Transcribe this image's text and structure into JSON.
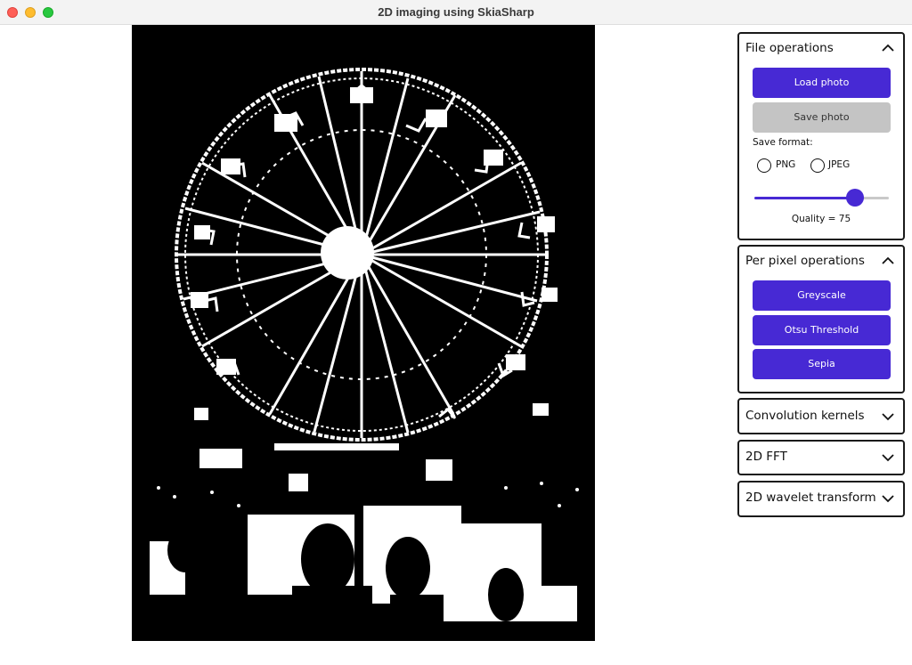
{
  "window": {
    "title": "2D imaging using SkiaSharp"
  },
  "photo": {
    "alt_name": "otsu-threshold-ferris-wheel"
  },
  "panels": {
    "file_operations": {
      "title": "File operations",
      "expanded": true,
      "load_label": "Load photo",
      "save_label": "Save photo",
      "save_format_label": "Save format:",
      "format_png": "PNG",
      "format_jpeg": "JPEG",
      "quality_value": 75,
      "quality_label": "Quality = 75"
    },
    "per_pixel": {
      "title": "Per pixel operations",
      "expanded": true,
      "greyscale_label": "Greyscale",
      "otsu_label": "Otsu Threshold",
      "sepia_label": "Sepia"
    },
    "convolution": {
      "title": "Convolution kernels",
      "expanded": false
    },
    "fft": {
      "title": "2D FFT",
      "expanded": false
    },
    "wavelet": {
      "title": "2D wavelet transform",
      "expanded": false
    }
  },
  "colors": {
    "accent": "#4729d4",
    "disabled_button": "#c4c4c4",
    "track_inactive": "#c9c9c9"
  },
  "icons": {
    "expanded": "chevron-up-icon",
    "collapsed": "chevron-down-icon"
  }
}
